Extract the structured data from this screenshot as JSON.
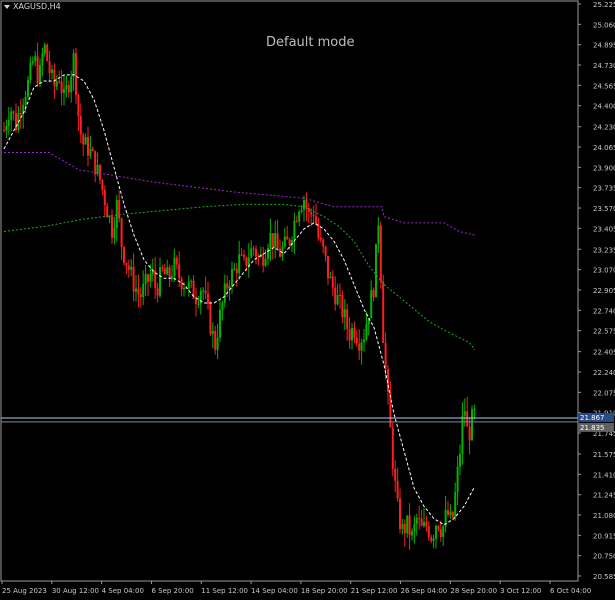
{
  "window": {
    "symbol": "XAGUSD,H4",
    "mode_text": "Default mode"
  },
  "colors": {
    "background": "#000000",
    "frame": "#9a9a9a",
    "bull_candle": "#00b400",
    "bear_candle": "#ff1e1e",
    "ma_dashed": "#ffffff",
    "green_line": "#22aa22",
    "purple_line": "#9c28c8",
    "bid_line": "#b4c8ff",
    "axis_text": "#c8c8c8"
  },
  "chart_data": {
    "type": "candlestick",
    "price_axis_labels": [
      "25.225",
      "25.060",
      "24.895",
      "24.730",
      "24.565",
      "24.400",
      "24.230",
      "24.065",
      "23.900",
      "23.735",
      "23.570",
      "23.405",
      "23.235",
      "23.070",
      "22.905",
      "22.740",
      "22.575",
      "22.405",
      "22.240",
      "22.075",
      "21.910",
      "21.745",
      "21.575",
      "21.410",
      "21.245",
      "21.080",
      "20.915",
      "20.750",
      "20.585"
    ],
    "price_tags": [
      "21.867",
      "21.835"
    ],
    "time_axis_labels": [
      "25 Aug 2023",
      "30 Aug 12:00",
      "4 Sep 04:00",
      "6 Sep 20:00",
      "11 Sep 12:00",
      "14 Sep 04:00",
      "18 Sep 20:00",
      "21 Sep 12:00",
      "26 Sep 04:00",
      "28 Sep 20:00",
      "3 Oct 12:00",
      "6 Oct 04:00"
    ],
    "ylim": [
      20.585,
      25.225
    ],
    "bid_price": 21.867,
    "ask_price": 21.835,
    "price_path": [
      [
        0,
        24.2
      ],
      [
        6,
        24.4
      ],
      [
        12,
        24.25
      ],
      [
        18,
        24.45
      ],
      [
        25,
        24.6
      ],
      [
        30,
        24.8
      ],
      [
        35,
        24.6
      ],
      [
        40,
        24.9
      ],
      [
        45,
        24.7
      ],
      [
        50,
        24.55
      ],
      [
        55,
        24.65
      ],
      [
        60,
        24.45
      ],
      [
        65,
        24.6
      ],
      [
        70,
        24.8
      ],
      [
        74,
        24.35
      ],
      [
        78,
        24.1
      ],
      [
        85,
        24.05
      ],
      [
        90,
        23.95
      ],
      [
        96,
        23.8
      ],
      [
        102,
        23.6
      ],
      [
        108,
        23.4
      ],
      [
        113,
        23.6
      ],
      [
        118,
        23.25
      ],
      [
        124,
        23.1
      ],
      [
        130,
        22.95
      ],
      [
        136,
        22.85
      ],
      [
        142,
        22.95
      ],
      [
        148,
        23.05
      ],
      [
        152,
        22.9
      ],
      [
        158,
        23.05
      ],
      [
        164,
        23.0
      ],
      [
        170,
        23.1
      ],
      [
        176,
        23.0
      ],
      [
        182,
        22.95
      ],
      [
        188,
        22.9
      ],
      [
        193,
        22.85
      ],
      [
        198,
        22.95
      ],
      [
        203,
        22.75
      ],
      [
        207,
        22.6
      ],
      [
        211,
        22.45
      ],
      [
        215,
        22.65
      ],
      [
        220,
        22.85
      ],
      [
        225,
        23.0
      ],
      [
        230,
        23.05
      ],
      [
        235,
        23.15
      ],
      [
        240,
        23.1
      ],
      [
        245,
        23.2
      ],
      [
        250,
        23.25
      ],
      [
        255,
        23.15
      ],
      [
        260,
        23.2
      ],
      [
        265,
        23.35
      ],
      [
        270,
        23.3
      ],
      [
        275,
        23.2
      ],
      [
        280,
        23.25
      ],
      [
        285,
        23.3
      ],
      [
        290,
        23.45
      ],
      [
        295,
        23.6
      ],
      [
        300,
        23.65
      ],
      [
        305,
        23.5
      ],
      [
        310,
        23.55
      ],
      [
        315,
        23.3
      ],
      [
        320,
        23.2
      ],
      [
        325,
        23.0
      ],
      [
        330,
        22.9
      ],
      [
        335,
        22.8
      ],
      [
        340,
        22.7
      ],
      [
        345,
        22.55
      ],
      [
        350,
        22.6
      ],
      [
        355,
        22.5
      ],
      [
        360,
        22.55
      ],
      [
        365,
        22.75
      ],
      [
        370,
        22.95
      ],
      [
        375,
        23.55
      ],
      [
        378,
        22.7
      ],
      [
        382,
        22.2
      ],
      [
        386,
        21.8
      ],
      [
        390,
        21.4
      ],
      [
        394,
        21.1
      ],
      [
        398,
        20.95
      ],
      [
        403,
        21.0
      ],
      [
        408,
        20.9
      ],
      [
        413,
        21.05
      ],
      [
        418,
        20.95
      ],
      [
        423,
        21.0
      ],
      [
        428,
        20.9
      ],
      [
        433,
        21.05
      ],
      [
        438,
        20.95
      ],
      [
        443,
        21.1
      ],
      [
        448,
        21.0
      ],
      [
        452,
        21.3
      ],
      [
        456,
        21.6
      ],
      [
        460,
        22.0
      ],
      [
        464,
        21.7
      ],
      [
        468,
        21.85
      ],
      [
        471,
        21.9
      ]
    ],
    "dashed_ma": [
      [
        0,
        24.05
      ],
      [
        10,
        24.2
      ],
      [
        20,
        24.35
      ],
      [
        30,
        24.55
      ],
      [
        40,
        24.6
      ],
      [
        50,
        24.6
      ],
      [
        60,
        24.65
      ],
      [
        70,
        24.65
      ],
      [
        80,
        24.6
      ],
      [
        90,
        24.45
      ],
      [
        100,
        24.2
      ],
      [
        110,
        23.9
      ],
      [
        120,
        23.6
      ],
      [
        130,
        23.35
      ],
      [
        140,
        23.15
      ],
      [
        150,
        23.05
      ],
      [
        160,
        23.0
      ],
      [
        170,
        23.0
      ],
      [
        180,
        22.95
      ],
      [
        190,
        22.85
      ],
      [
        200,
        22.8
      ],
      [
        210,
        22.8
      ],
      [
        220,
        22.85
      ],
      [
        230,
        22.95
      ],
      [
        240,
        23.05
      ],
      [
        250,
        23.15
      ],
      [
        260,
        23.2
      ],
      [
        270,
        23.25
      ],
      [
        280,
        23.2
      ],
      [
        290,
        23.3
      ],
      [
        300,
        23.4
      ],
      [
        310,
        23.45
      ],
      [
        320,
        23.4
      ],
      [
        330,
        23.3
      ],
      [
        340,
        23.15
      ],
      [
        350,
        22.95
      ],
      [
        360,
        22.75
      ],
      [
        370,
        22.6
      ],
      [
        380,
        22.3
      ],
      [
        390,
        21.9
      ],
      [
        400,
        21.6
      ],
      [
        410,
        21.3
      ],
      [
        420,
        21.15
      ],
      [
        430,
        21.05
      ],
      [
        440,
        21.0
      ],
      [
        450,
        21.05
      ],
      [
        460,
        21.15
      ],
      [
        470,
        21.3
      ]
    ],
    "green_line": [
      [
        0,
        23.38
      ],
      [
        40,
        23.42
      ],
      [
        80,
        23.48
      ],
      [
        120,
        23.52
      ],
      [
        160,
        23.55
      ],
      [
        200,
        23.58
      ],
      [
        240,
        23.6
      ],
      [
        280,
        23.6
      ],
      [
        300,
        23.58
      ],
      [
        320,
        23.5
      ],
      [
        335,
        23.42
      ],
      [
        350,
        23.3
      ],
      [
        365,
        23.1
      ],
      [
        380,
        22.95
      ],
      [
        395,
        22.85
      ],
      [
        410,
        22.75
      ],
      [
        425,
        22.65
      ],
      [
        440,
        22.58
      ],
      [
        455,
        22.52
      ],
      [
        465,
        22.48
      ],
      [
        471,
        22.42
      ]
    ],
    "purple_line": [
      [
        0,
        24.02
      ],
      [
        45,
        24.02
      ],
      [
        75,
        23.88
      ],
      [
        150,
        23.78
      ],
      [
        230,
        23.7
      ],
      [
        300,
        23.65
      ],
      [
        330,
        23.58
      ],
      [
        378,
        23.58
      ],
      [
        380,
        23.5
      ],
      [
        400,
        23.45
      ],
      [
        440,
        23.45
      ],
      [
        455,
        23.38
      ],
      [
        471,
        23.35
      ]
    ]
  }
}
